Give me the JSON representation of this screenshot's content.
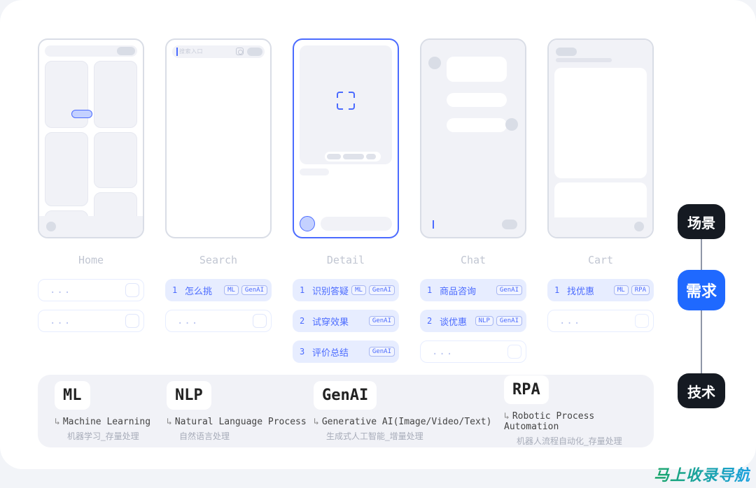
{
  "domain": "Diagram",
  "columns": [
    {
      "key": "home",
      "label": "Home",
      "scenarios": [
        {
          "type": "empty",
          "dots": "..."
        },
        {
          "type": "empty",
          "dots": "..."
        }
      ]
    },
    {
      "key": "search",
      "label": "Search",
      "search_placeholder": "搜索入口",
      "scenarios": [
        {
          "type": "item",
          "index": "1",
          "text": "怎么挑",
          "tags": [
            "ML",
            "GenAI"
          ]
        },
        {
          "type": "empty",
          "dots": "..."
        }
      ]
    },
    {
      "key": "detail",
      "label": "Detail",
      "scenarios": [
        {
          "type": "item",
          "index": "1",
          "text": "识别答疑",
          "tags": [
            "ML",
            "GenAI"
          ]
        },
        {
          "type": "item",
          "index": "2",
          "text": "试穿效果",
          "tags": [
            "GenAI"
          ]
        },
        {
          "type": "item",
          "index": "3",
          "text": "评价总结",
          "tags": [
            "GenAI"
          ]
        }
      ]
    },
    {
      "key": "chat",
      "label": "Chat",
      "scenarios": [
        {
          "type": "item",
          "index": "1",
          "text": "商品咨询",
          "tags": [
            "GenAI"
          ]
        },
        {
          "type": "item",
          "index": "2",
          "text": "谈优惠",
          "tags": [
            "NLP",
            "GenAI"
          ]
        },
        {
          "type": "empty",
          "dots": "..."
        }
      ]
    },
    {
      "key": "cart",
      "label": "Cart",
      "scenarios": [
        {
          "type": "item",
          "index": "1",
          "text": "找优惠",
          "tags": [
            "ML",
            "RPA"
          ]
        },
        {
          "type": "empty",
          "dots": "..."
        }
      ]
    }
  ],
  "tech": [
    {
      "abbr": "ML",
      "full": "Machine Learning",
      "sub": "机器学习_存量处理"
    },
    {
      "abbr": "NLP",
      "full": "Natural Language Process",
      "sub": "自然语言处理"
    },
    {
      "abbr": "GenAI",
      "full": "Generative AI(Image/Video/Text)",
      "sub": "生成式人工智能_增量处理"
    },
    {
      "abbr": "RPA",
      "full": "Robotic Process Automation",
      "sub": "机器人流程自动化_存量处理"
    }
  ],
  "right_nav": {
    "top": "场景",
    "mid": "需求",
    "bot": "技术"
  },
  "arrow_glyph": "↳",
  "watermark": "马上收录导航"
}
